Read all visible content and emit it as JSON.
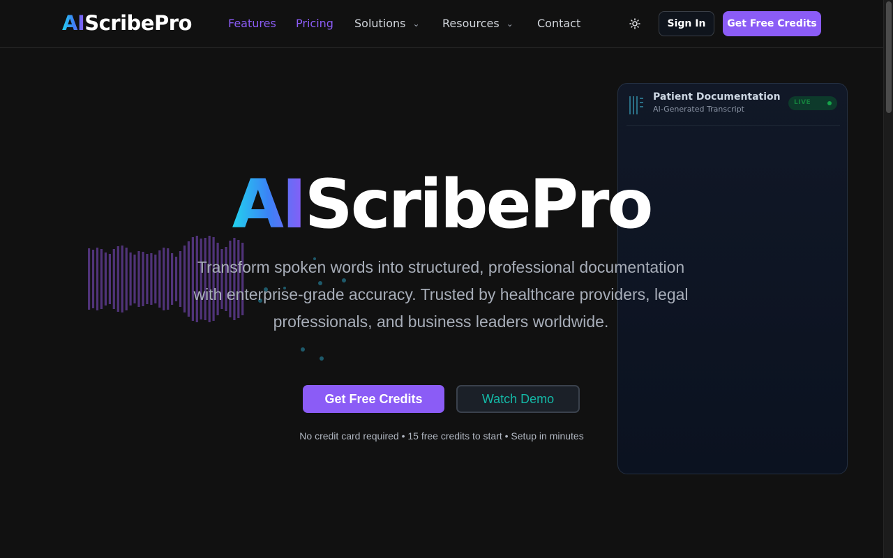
{
  "brand": {
    "logo_ai": "AI",
    "logo_rest": "ScribePro",
    "accent": "#8b5cf6",
    "teal": "#14b8a6"
  },
  "nav": {
    "items": [
      {
        "label": "Features",
        "active": true
      },
      {
        "label": "Pricing",
        "active": true
      },
      {
        "label": "Solutions",
        "dropdown": true
      },
      {
        "label": "Resources",
        "dropdown": true
      },
      {
        "label": "Contact"
      }
    ],
    "theme_icon": "sun-icon",
    "sign_in": "Sign In",
    "cta": "Get Free Credits"
  },
  "hero": {
    "title_ai": "AI",
    "title_rest": "ScribePro",
    "subtitle": "Transform spoken words into structured, professional documentation with enterprise-grade accuracy. Trusted by healthcare providers, legal professionals, and business leaders worldwide.",
    "primary_cta": "Get Free Credits",
    "secondary_cta": "Watch Demo",
    "note": "No credit card required • 15 free credits to start • Setup in minutes"
  },
  "card": {
    "icon": "transcript-icon",
    "title": "Patient Documentation",
    "subtitle": "AI-Generated Transcript",
    "badge": "LIVE"
  }
}
